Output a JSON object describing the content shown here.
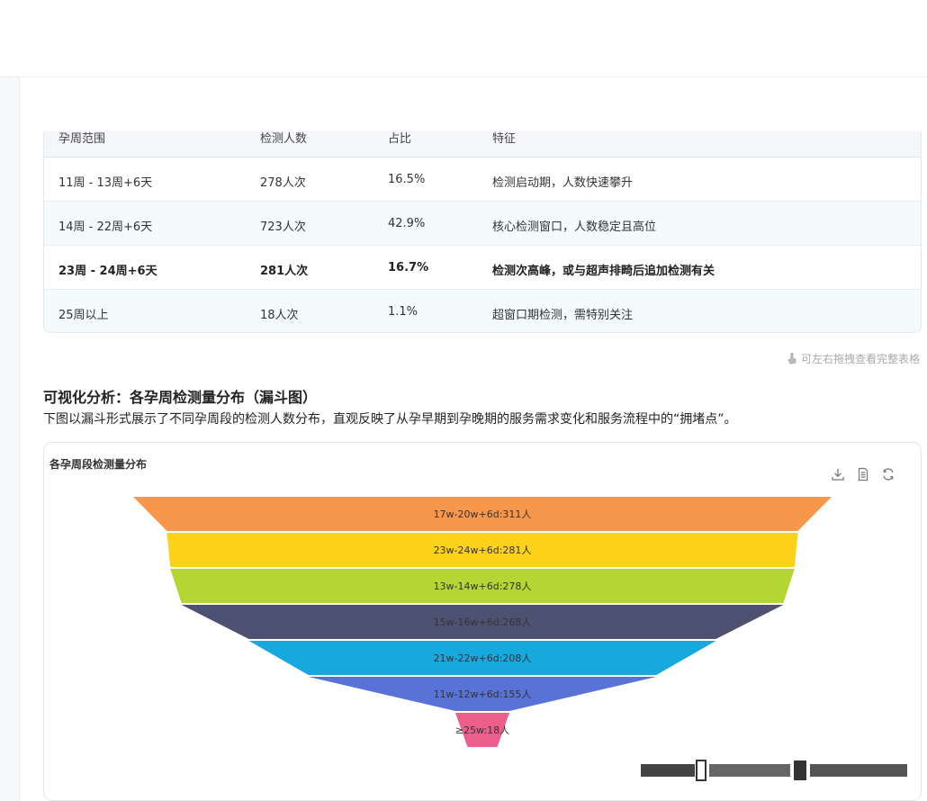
{
  "table": {
    "headers": [
      "孕周范围",
      "检测人数",
      "占比",
      "特征"
    ],
    "rows": [
      {
        "range": "11周 - 13周+6天",
        "count": "278人次",
        "percent": "16.5%",
        "feature": "检测启动期，人数快速攀升",
        "bold": false
      },
      {
        "range": "14周 - 22周+6天",
        "count": "723人次",
        "percent": "42.9%",
        "feature": "核心检测窗口，人数稳定且高位",
        "bold": false
      },
      {
        "range": "23周 - 24周+6天",
        "count": "281人次",
        "percent": "16.7%",
        "feature": "检测次高峰，或与超声排畸后追加检测有关",
        "bold": true
      },
      {
        "range": "25周以上",
        "count": "18人次",
        "percent": "1.1%",
        "feature": "超窗口期检测，需特别关注",
        "bold": false
      }
    ]
  },
  "hint": "可左右拖拽查看完整表格",
  "section": {
    "title": "可视化分析：各孕周检测量分布（漏斗图）",
    "description": "下图以漏斗形式展示了不同孕周段的检测人数分布，直观反映了从孕早期到孕晚期的服务需求变化和服务流程中的“拥堵点”。"
  },
  "chart": {
    "title": "各孕周段检测量分布",
    "tools": [
      "download-icon",
      "data-view-icon",
      "refresh-icon"
    ]
  },
  "chart_data": {
    "type": "funnel",
    "title": "各孕周段检测量分布",
    "sort": "descending",
    "series": [
      {
        "label": "17w-20w+6d:311人",
        "value": 311,
        "color": "#f7974c"
      },
      {
        "label": "23w-24w+6d:281人",
        "value": 281,
        "color": "#fbd11a"
      },
      {
        "label": "13w-14w+6d:278人",
        "value": 278,
        "color": "#b3d633"
      },
      {
        "label": "15w-16w+6d:268人",
        "value": 268,
        "color": "#4e5272"
      },
      {
        "label": "21w-22w+6d:208人",
        "value": 208,
        "color": "#17a9de"
      },
      {
        "label": "11w-12w+6d:155人",
        "value": 155,
        "color": "#5873d5"
      },
      {
        "label": "≥25w:18人",
        "value": 18,
        "color": "#ec5f8c"
      }
    ]
  }
}
